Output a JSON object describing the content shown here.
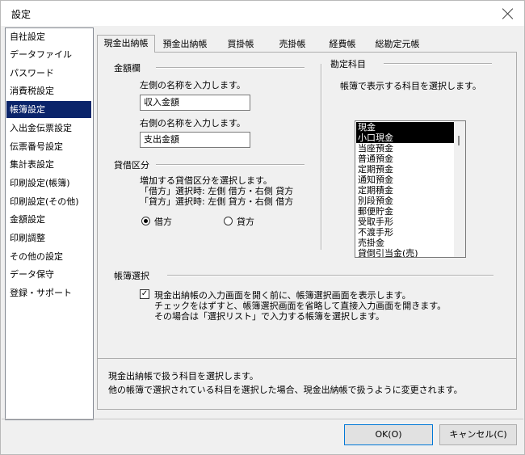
{
  "window": {
    "title": "設定"
  },
  "sidebar": {
    "items": [
      {
        "label": "自社設定"
      },
      {
        "label": "データファイル"
      },
      {
        "label": "パスワード"
      },
      {
        "label": "消費税設定"
      },
      {
        "label": "帳簿設定"
      },
      {
        "label": "入出金伝票設定"
      },
      {
        "label": "伝票番号設定"
      },
      {
        "label": "集計表設定"
      },
      {
        "label": "印刷設定(帳簿)"
      },
      {
        "label": "印刷設定(その他)"
      },
      {
        "label": "金額設定"
      },
      {
        "label": "印刷調整"
      },
      {
        "label": "その他の設定"
      },
      {
        "label": "データ保守"
      },
      {
        "label": "登録・サポート"
      }
    ],
    "selected": "帳簿設定"
  },
  "tabs": [
    {
      "label": "現金出納帳"
    },
    {
      "label": "預金出納帳"
    },
    {
      "label": "買掛帳"
    },
    {
      "label": "売掛帳"
    },
    {
      "label": "経費帳"
    },
    {
      "label": "総勘定元帳"
    }
  ],
  "amount": {
    "heading": "金額欄",
    "left_prompt": "左側の名称を入力します。",
    "left_value": "収入金額",
    "right_prompt": "右側の名称を入力します。",
    "right_value": "支出金額"
  },
  "debit_credit": {
    "heading": "貸借区分",
    "desc1": "増加する貸借区分を選択します。",
    "desc2": "「借方」選択時: 左側 借方・右側 貸方",
    "desc3": "「貸方」選択時: 左側 貸方・右側 借方",
    "option1": "借方",
    "option2": "貸方",
    "selected": "借方"
  },
  "accounts": {
    "heading": "勘定科目",
    "prompt": "帳簿で表示する科目を選択します。",
    "items": [
      {
        "label": "現金"
      },
      {
        "label": "小口現金"
      },
      {
        "label": "当座預金"
      },
      {
        "label": "普通預金"
      },
      {
        "label": "定期預金"
      },
      {
        "label": "通知預金"
      },
      {
        "label": "定期積金"
      },
      {
        "label": "別段預金"
      },
      {
        "label": "郵便貯金"
      },
      {
        "label": "受取手形"
      },
      {
        "label": "不渡手形"
      },
      {
        "label": "売掛金"
      },
      {
        "label": "貸倒引当金(売)"
      }
    ],
    "selected": [
      "現金",
      "小口現金"
    ]
  },
  "book_selection": {
    "heading": "帳簿選択",
    "checkbox_text1": "現金出納帳の入力画面を開く前に、帳簿選択画面を表示します。",
    "checkbox_text2": "チェックをはずすと、帳簿選択画面を省略して直接入力画面を開きます。",
    "checkbox_text3": "その場合は「選択リスト」で入力する帳簿を選択します。",
    "checked": true
  },
  "help": {
    "line1": "現金出納帳で扱う科目を選択します。",
    "line2": "他の帳簿で選択されている科目を選択した場合、現金出納帳で扱うように変更されます。"
  },
  "buttons": {
    "ok": "OK(O)",
    "cancel": "キャンセル(C)"
  }
}
